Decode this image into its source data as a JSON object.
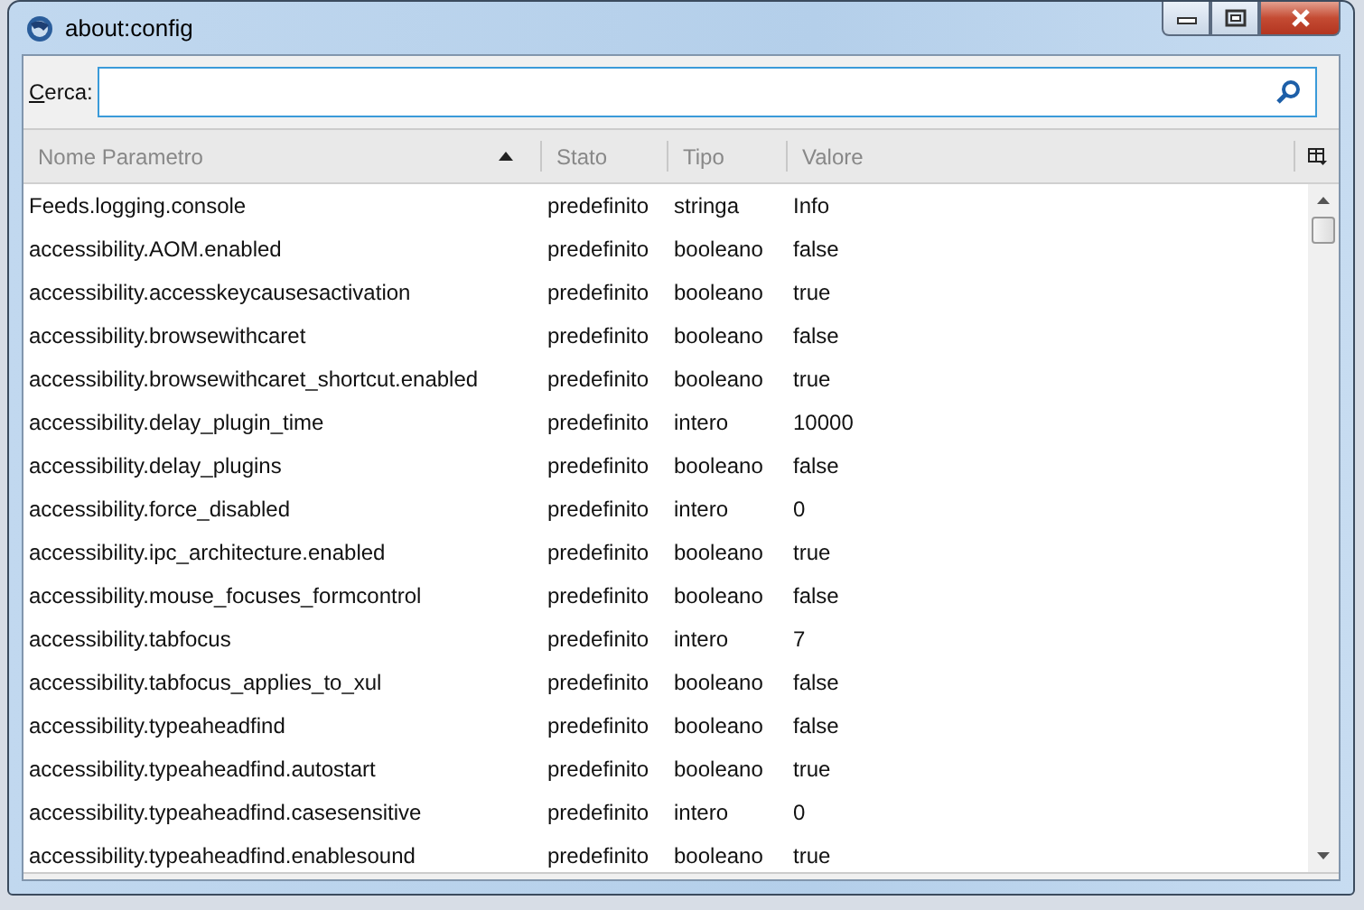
{
  "window": {
    "title": "about:config"
  },
  "search": {
    "label": "Cerca:"
  },
  "table": {
    "columns": [
      {
        "label": "Nome Parametro",
        "sorted": true
      },
      {
        "label": "Stato",
        "sorted": false
      },
      {
        "label": "Tipo",
        "sorted": false
      },
      {
        "label": "Valore",
        "sorted": false
      }
    ],
    "rows": [
      [
        "Feeds.logging.console",
        "predefinito",
        "stringa",
        "Info"
      ],
      [
        "accessibility.AOM.enabled",
        "predefinito",
        "booleano",
        "false"
      ],
      [
        "accessibility.accesskeycausesactivation",
        "predefinito",
        "booleano",
        "true"
      ],
      [
        "accessibility.browsewithcaret",
        "predefinito",
        "booleano",
        "false"
      ],
      [
        "accessibility.browsewithcaret_shortcut.enabled",
        "predefinito",
        "booleano",
        "true"
      ],
      [
        "accessibility.delay_plugin_time",
        "predefinito",
        "intero",
        "10000"
      ],
      [
        "accessibility.delay_plugins",
        "predefinito",
        "booleano",
        "false"
      ],
      [
        "accessibility.force_disabled",
        "predefinito",
        "intero",
        "0"
      ],
      [
        "accessibility.ipc_architecture.enabled",
        "predefinito",
        "booleano",
        "true"
      ],
      [
        "accessibility.mouse_focuses_formcontrol",
        "predefinito",
        "booleano",
        "false"
      ],
      [
        "accessibility.tabfocus",
        "predefinito",
        "intero",
        "7"
      ],
      [
        "accessibility.tabfocus_applies_to_xul",
        "predefinito",
        "booleano",
        "false"
      ],
      [
        "accessibility.typeaheadfind",
        "predefinito",
        "booleano",
        "false"
      ],
      [
        "accessibility.typeaheadfind.autostart",
        "predefinito",
        "booleano",
        "true"
      ],
      [
        "accessibility.typeaheadfind.casesensitive",
        "predefinito",
        "intero",
        "0"
      ],
      [
        "accessibility.typeaheadfind.enablesound",
        "predefinito",
        "booleano",
        "true"
      ]
    ]
  }
}
